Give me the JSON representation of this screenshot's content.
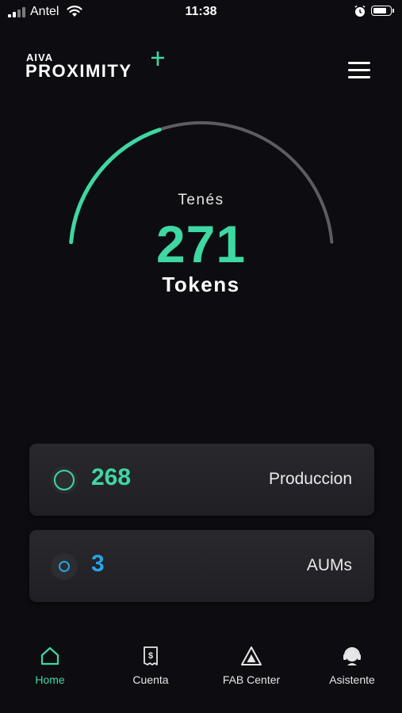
{
  "status_bar": {
    "carrier": "Antel",
    "time": "11:38",
    "battery_level": 0.85,
    "icons": [
      "signal-icon",
      "wifi-icon",
      "alarm-icon",
      "battery-icon"
    ]
  },
  "header": {
    "logo_small": "AIVA",
    "logo_big": "PROXIMITY",
    "menu_icon": "hamburger-menu-icon"
  },
  "gauge": {
    "label": "Tenés",
    "value": "271",
    "unit": "Tokens",
    "fill_fraction": 0.39,
    "accent_color": "#3fd7a2",
    "track_color": "#5c5c62"
  },
  "cards": [
    {
      "value": "268",
      "name": "Produccion",
      "value_color": "#3fd7a2",
      "icon": "ring-icon"
    },
    {
      "value": "3",
      "name": "AUMs",
      "value_color": "#2aa2e6",
      "icon": "dot-ring-icon"
    }
  ],
  "nav": {
    "items": [
      {
        "label": "Home",
        "icon": "home-icon",
        "active": true
      },
      {
        "label": "Cuenta",
        "icon": "receipt-dollar-icon",
        "active": false
      },
      {
        "label": "FAB Center",
        "icon": "triangle-icon",
        "active": false
      },
      {
        "label": "Asistente",
        "icon": "assistant-headset-icon",
        "active": false
      }
    ]
  }
}
